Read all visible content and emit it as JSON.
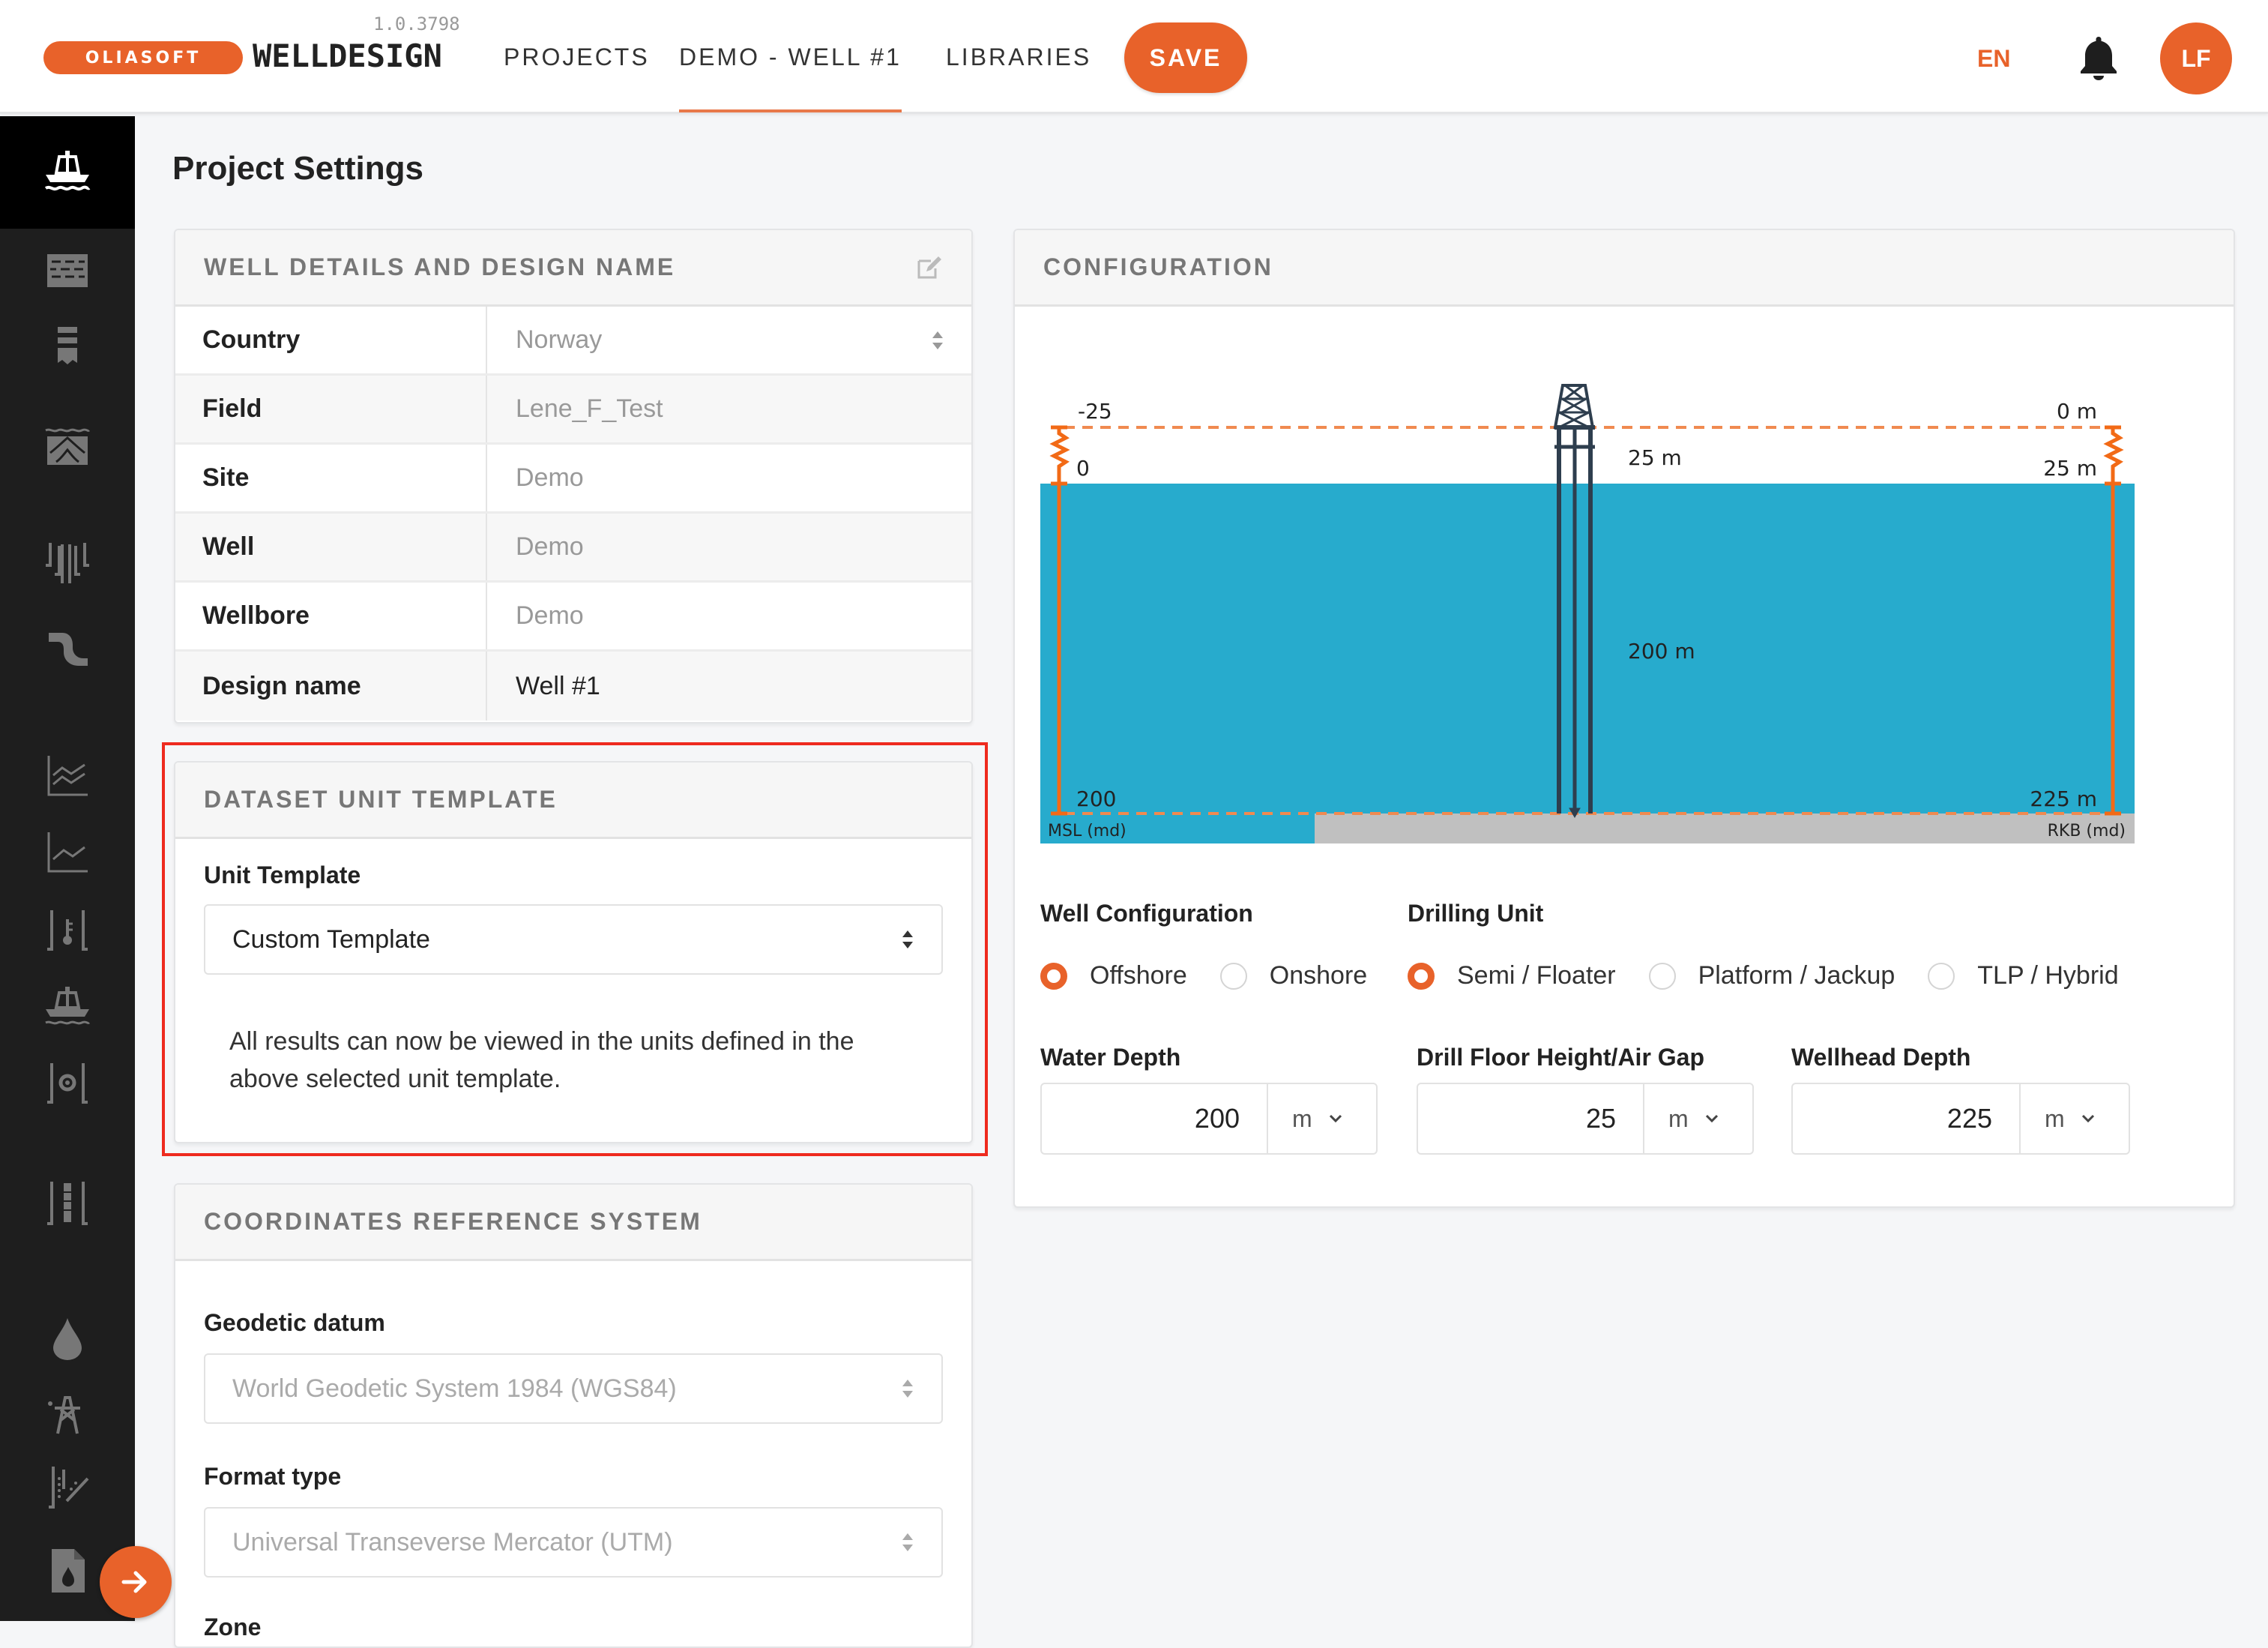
{
  "header": {
    "logo_text": "OLIASOFT",
    "brand": "WELLDESIGN",
    "version": "1.0.3798",
    "nav": [
      {
        "label": "PROJECTS",
        "active": false
      },
      {
        "label": "DEMO - WELL #1",
        "active": true
      },
      {
        "label": "LIBRARIES",
        "active": false
      }
    ],
    "save_label": "SAVE",
    "language": "EN",
    "avatar_initials": "LF"
  },
  "sidebar": {
    "items": [
      {
        "icon": "offshore-rig-icon",
        "active": true
      },
      {
        "icon": "formation-bricks-icon",
        "active": false
      },
      {
        "icon": "casing-shoe-icon",
        "active": false
      },
      {
        "icon": "seabed-formation-icon",
        "active": false
      },
      {
        "icon": "wellbore-strings-icon",
        "active": false
      },
      {
        "icon": "trajectory-pipe-icon",
        "active": false
      },
      {
        "icon": "multi-line-chart-icon",
        "active": false
      },
      {
        "icon": "line-chart-icon",
        "active": false
      },
      {
        "icon": "temperature-well-icon",
        "active": false
      },
      {
        "icon": "rig-icon",
        "active": false
      },
      {
        "icon": "wellhead-gear-icon",
        "active": false
      },
      {
        "icon": "casing-string-icon",
        "active": false
      },
      {
        "icon": "fluid-drop-icon",
        "active": false
      },
      {
        "icon": "derrick-icon",
        "active": false
      },
      {
        "icon": "cement-flow-icon",
        "active": false
      },
      {
        "icon": "report-file-icon",
        "active": false
      }
    ],
    "expand_icon": "arrow-right-icon"
  },
  "page": {
    "title": "Project Settings"
  },
  "well_details": {
    "title": "WELL DETAILS AND DESIGN NAME",
    "rows": [
      {
        "label": "Country",
        "value": "Norway",
        "type": "select"
      },
      {
        "label": "Field",
        "value": "Lene_F_Test",
        "type": "text"
      },
      {
        "label": "Site",
        "value": "Demo",
        "type": "text"
      },
      {
        "label": "Well",
        "value": "Demo",
        "type": "text"
      },
      {
        "label": "Wellbore",
        "value": "Demo",
        "type": "text"
      },
      {
        "label": "Design name",
        "value": "Well #1",
        "type": "text"
      }
    ]
  },
  "dataset_unit_template": {
    "title": "DATASET UNIT TEMPLATE",
    "unit_template_label": "Unit Template",
    "unit_template_value": "Custom Template",
    "help_text": "All results can now be viewed in the units defined in the above selected unit template."
  },
  "crs": {
    "title": "COORDINATES REFERENCE SYSTEM",
    "geodetic_datum_label": "Geodetic datum",
    "geodetic_datum_value": "World Geodetic System 1984 (WGS84)",
    "format_type_label": "Format type",
    "format_type_value": "Universal Transeverse Mercator (UTM)",
    "zone_label": "Zone"
  },
  "configuration": {
    "title": "CONFIGURATION",
    "diagram": {
      "msl_top": "-25",
      "msl_zero": "0",
      "msl_bottom": "200",
      "msl_axis_label": "MSL (md)",
      "air_gap_label": "25 m",
      "water_depth_label": "200 m",
      "rkb_top": "0 m",
      "rkb_sea": "25 m",
      "rkb_bottom": "225 m",
      "rkb_axis_label": "RKB (md)",
      "colors": {
        "water": "#27abcd",
        "seabed": "#c0c0c0",
        "scale": "#f26a16",
        "rig": "#2e3e4e"
      }
    },
    "well_configuration_label": "Well Configuration",
    "well_configuration_options": [
      {
        "label": "Offshore",
        "selected": true
      },
      {
        "label": "Onshore",
        "selected": false
      }
    ],
    "drilling_unit_label": "Drilling Unit",
    "drilling_unit_options": [
      {
        "label": "Semi / Floater",
        "selected": true
      },
      {
        "label": "Platform / Jackup",
        "selected": false
      },
      {
        "label": "TLP / Hybrid",
        "selected": false
      }
    ],
    "water_depth": {
      "label": "Water Depth",
      "value": "200",
      "unit": "m"
    },
    "drill_floor_height": {
      "label": "Drill Floor Height/Air Gap",
      "value": "25",
      "unit": "m"
    },
    "wellhead_depth": {
      "label": "Wellhead Depth",
      "value": "225",
      "unit": "m"
    }
  },
  "colors": {
    "accent": "#e8622a",
    "sidebar_bg": "#1e1e1e",
    "highlight_border": "#ee2b1f"
  }
}
